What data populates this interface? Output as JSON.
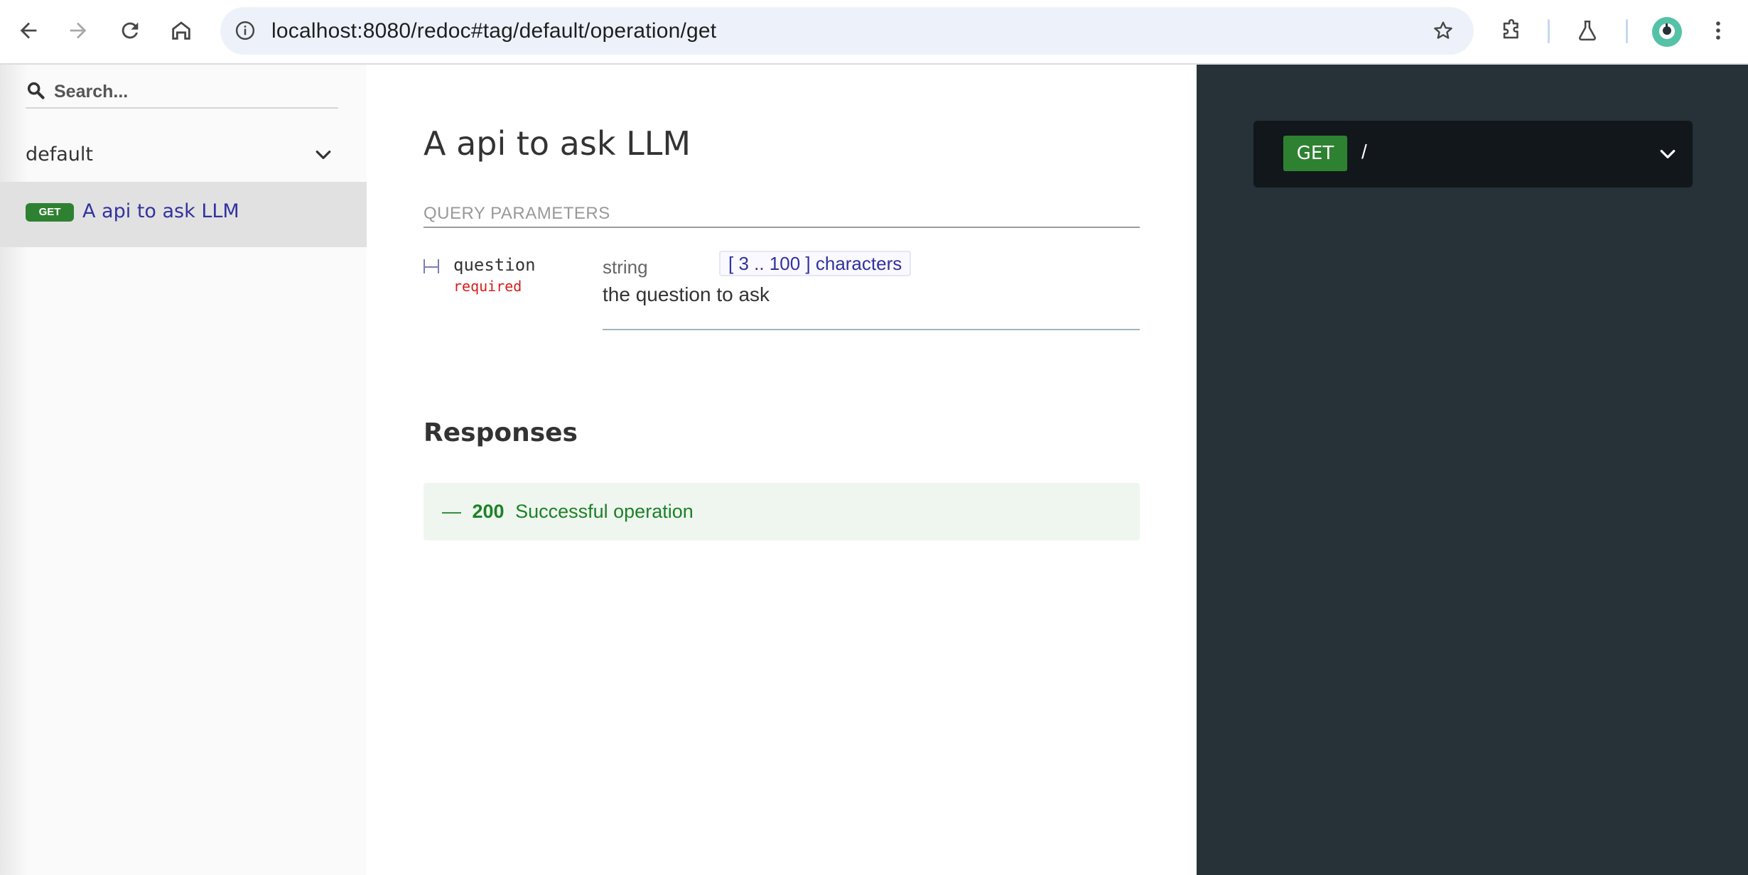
{
  "browser": {
    "url": "localhost:8080/redoc#tag/default/operation/get",
    "back_icon": "arrow-left-icon",
    "forward_icon": "arrow-right-icon",
    "reload_icon": "reload-icon",
    "home_icon": "home-icon"
  },
  "sidebar": {
    "search_placeholder": "Search...",
    "group_label": "default",
    "items": [
      {
        "method": "GET",
        "label": "A api to ask LLM",
        "selected": true
      }
    ]
  },
  "operation": {
    "title": "A api to ask LLM",
    "query_params_heading": "QUERY PARAMETERS",
    "params": [
      {
        "name": "question",
        "required_label": "required",
        "type": "string",
        "constraint": "[ 3 .. 100 ] characters",
        "description": "the question to ask"
      }
    ],
    "responses_heading": "Responses",
    "responses": [
      {
        "prefix": "—",
        "code": "200",
        "description": "Successful operation"
      }
    ]
  },
  "endpoint": {
    "method": "GET",
    "path": "/"
  },
  "colors": {
    "get_green": "#2f8132",
    "sidebar_link": "#32329f",
    "dark_panel": "#263238",
    "required_red": "#d41f1c",
    "success_text": "#1d8127"
  }
}
